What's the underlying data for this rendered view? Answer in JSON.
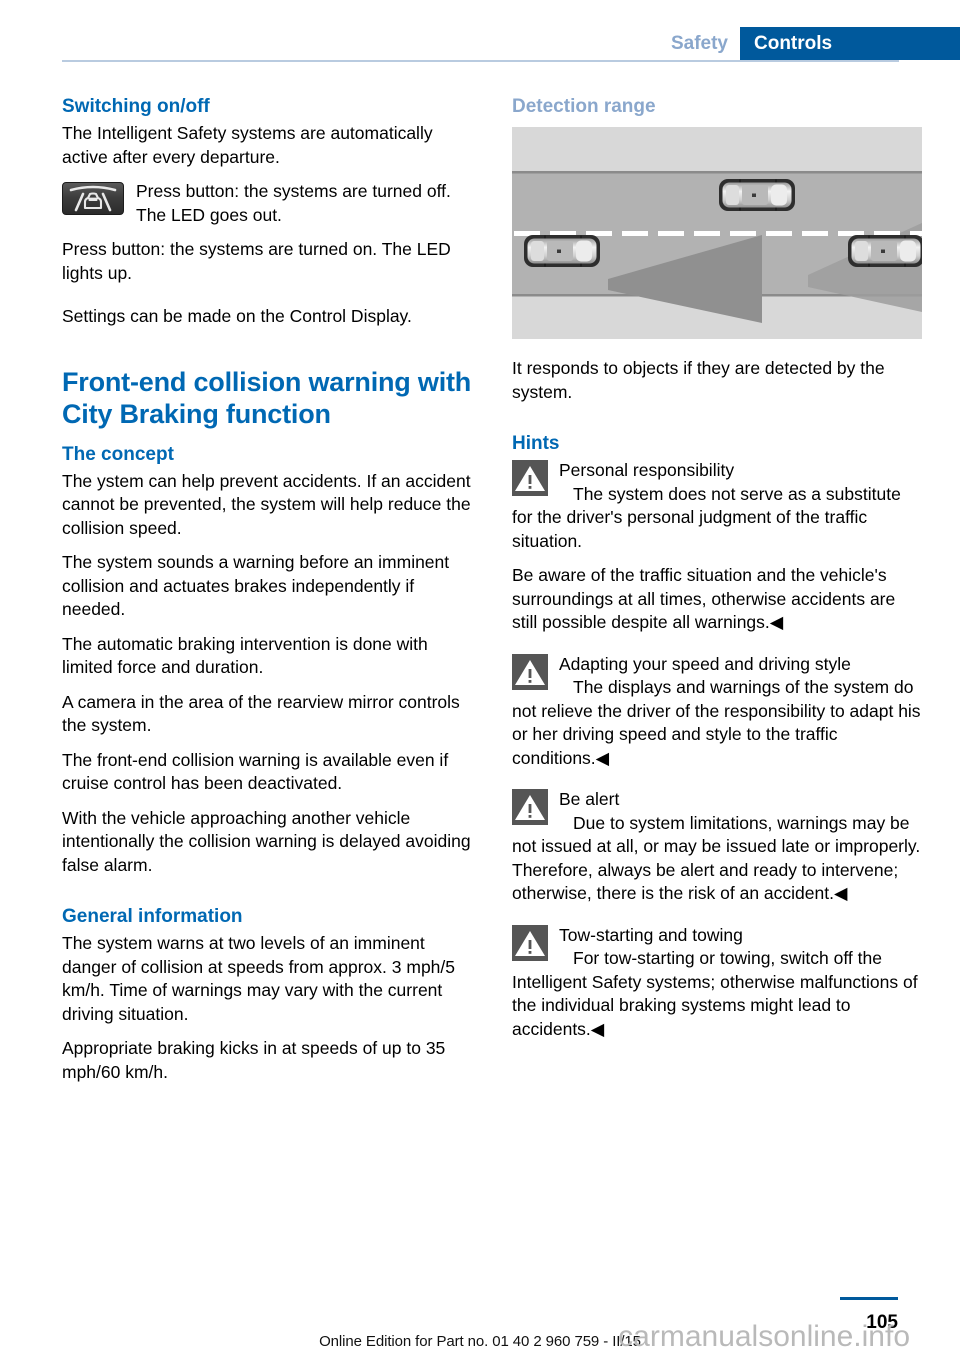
{
  "header": {
    "tab_inactive": "Safety",
    "tab_active": "Controls",
    "active_color": "#00599c",
    "inactive_color": "#8aa7cc"
  },
  "left_column": {
    "switching_heading": "Switching on/off",
    "switching_p1": "The Intelligent Safety systems are automatically active after every departure.",
    "button_icon_name": "intelligent-safety-button-icon",
    "switching_icon_text": "Press button: the systems are turned off. The LED goes out.",
    "switching_p2": "Press button: the systems are turned on. The LED lights up.",
    "switching_p3": "Settings can be made on the Control Display.",
    "chapter_heading": "Front-end collision warning with City Braking function",
    "concept_heading": "The concept",
    "concept_p1": "The ystem can help prevent accidents. If an accident cannot be prevented, the system will help reduce the collision speed.",
    "concept_p2": "The system sounds a warning before an imminent collision and actuates brakes independently if needed.",
    "concept_p3": "The automatic braking intervention is done with limited force and duration.",
    "concept_p4": "A camera in the area of the rearview mirror controls the system.",
    "concept_p5": "The front-end collision warning is available even if cruise control has been deactivated.",
    "concept_p6": "With the vehicle approaching another vehicle intentionally the collision warning is delayed avoiding false alarm.",
    "general_heading": "General information",
    "general_p1": "The system warns at two levels of an imminent danger of collision at speeds from approx. 3 mph/5 km/h. Time of warnings may vary with the current driving situation.",
    "general_p2": "Appropriate braking kicks in at speeds of up to 35 mph/60 km/h."
  },
  "right_column": {
    "detection_heading": "Detection range",
    "detection_heading_color": "#8aa7cc",
    "diagram_name": "detection-range-diagram",
    "detection_p1": "It responds to objects if they are detected by the system.",
    "hints_heading": "Hints",
    "hints_heading_color": "#0068b3",
    "hints": [
      {
        "title": "Personal responsibility",
        "body": "The system does not serve as a substitute for the driver's personal judgment of the traffic situation.",
        "continuation": "Be aware of the traffic situation and the vehicle's surroundings at all times, otherwise accidents are still possible despite all warnings.◀"
      },
      {
        "title": "Adapting your speed and driving style",
        "body": "The displays and warnings of the system do not relieve the driver of the responsibility to adapt his or her driving speed and style to the traffic conditions.◀",
        "continuation": ""
      },
      {
        "title": "Be alert",
        "body": "Due to system limitations, warnings may be not issued at all, or may be issued late or improperly. Therefore, always be alert and ready to intervene; otherwise, there is the risk of an accident.◀",
        "continuation": ""
      },
      {
        "title": "Tow-starting and towing",
        "body": "For tow-starting or towing, switch off the Intelligent Safety systems; otherwise malfunctions of the individual braking systems might lead to accidents.◀",
        "continuation": ""
      }
    ]
  },
  "footer": {
    "note": "Online Edition for Part no. 01 40 2 960 759 - II/15",
    "page_number": "105",
    "watermark": "carmanualsonline.info",
    "rule_color": "#00599c"
  }
}
